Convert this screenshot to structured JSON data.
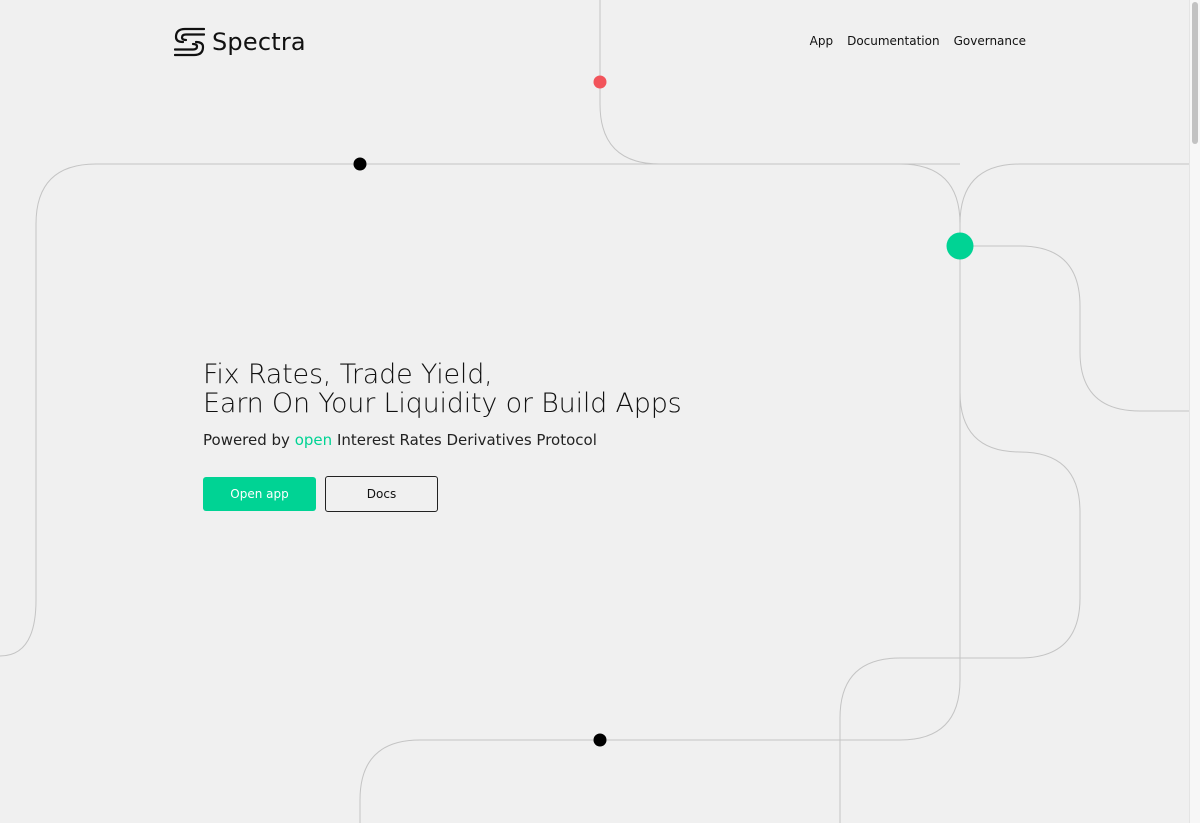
{
  "brand": {
    "name": "Spectra",
    "logo_icon": "spectra-logo-icon"
  },
  "nav": {
    "items": [
      {
        "label": "App"
      },
      {
        "label": "Documentation"
      },
      {
        "label": "Governance"
      }
    ]
  },
  "hero": {
    "title_line1": "Fix Rates, Trade Yield,",
    "title_line2": "Earn On Your Liquidity or Build Apps",
    "subtitle_prefix": "Powered by",
    "subtitle_accent": "open",
    "subtitle_suffix": "Interest Rates Derivatives Protocol",
    "primary_button": "Open app",
    "secondary_button": "Docs"
  },
  "colors": {
    "background": "#f0f0f0",
    "accent": "#00d394",
    "dot_red": "#f2545b",
    "dot_dark": "#000000",
    "line": "#c4c4c4"
  }
}
